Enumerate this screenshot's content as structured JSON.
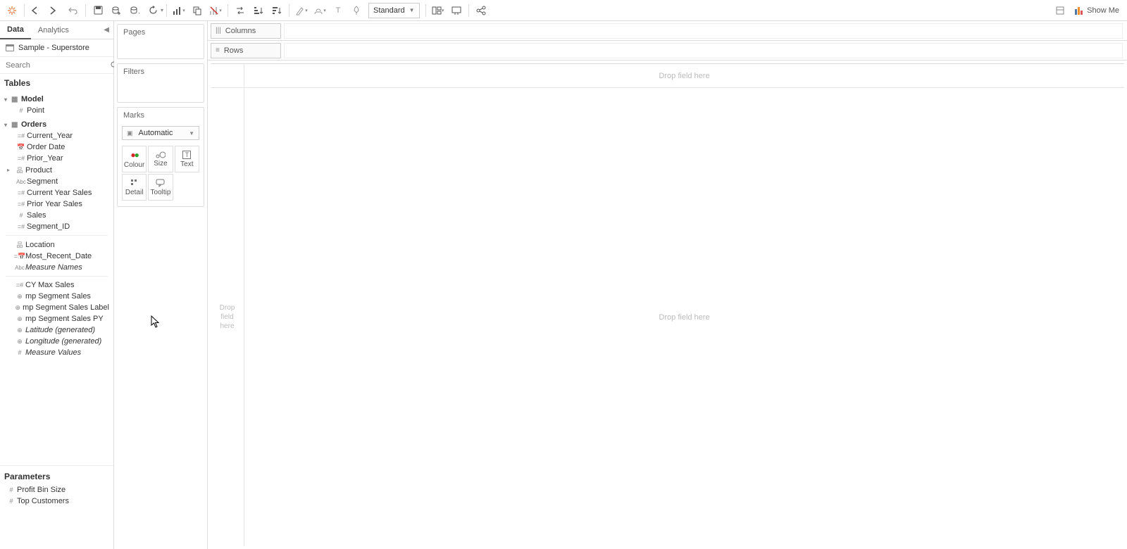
{
  "toolbar": {
    "fit_dropdown": "Standard",
    "showme": "Show Me"
  },
  "side": {
    "tabs": [
      "Data",
      "Analytics"
    ],
    "datasource": "Sample - Superstore",
    "search_placeholder": "Search",
    "tables_hdr": "Tables",
    "groups": [
      {
        "name": "Model",
        "items": [
          {
            "icon": "#",
            "label": "Point"
          }
        ]
      },
      {
        "name": "Orders",
        "items": [
          {
            "icon": "#",
            "label": "Current_Year"
          },
          {
            "icon": "cal",
            "label": "Order Date"
          },
          {
            "icon": "#",
            "label": "Prior_Year"
          },
          {
            "icon": "hier",
            "label": "Product",
            "caret": true
          },
          {
            "icon": "Abc",
            "label": "Segment"
          },
          {
            "icon": "=#",
            "label": "Current Year Sales"
          },
          {
            "icon": "=#",
            "label": "Prior Year Sales"
          },
          {
            "icon": "#",
            "label": "Sales"
          },
          {
            "icon": "=#",
            "label": "Segment_ID"
          }
        ]
      }
    ],
    "extra": [
      {
        "icon": "hier",
        "label": "Location",
        "caret": true
      },
      {
        "icon": "=cal",
        "label": "Most_Recent_Date"
      },
      {
        "icon": "Abc",
        "label": "Measure Names",
        "italic": true
      },
      {
        "icon": "=#",
        "label": "CY Max Sales"
      },
      {
        "icon": "globe",
        "label": "mp Segment Sales"
      },
      {
        "icon": "globe",
        "label": "mp Segment Sales Label"
      },
      {
        "icon": "globe",
        "label": "mp Segment Sales PY"
      },
      {
        "icon": "globe",
        "label": "Latitude (generated)",
        "italic": true
      },
      {
        "icon": "globe",
        "label": "Longitude (generated)",
        "italic": true
      },
      {
        "icon": "#",
        "label": "Measure Values",
        "italic": true
      }
    ],
    "params_hdr": "Parameters",
    "params": [
      {
        "icon": "#",
        "label": "Profit Bin Size"
      },
      {
        "icon": "#",
        "label": "Top Customers"
      }
    ]
  },
  "shelves": {
    "pages": "Pages",
    "filters": "Filters",
    "marks": "Marks",
    "marks_type": "Automatic",
    "mark_btns": [
      "Colour",
      "Size",
      "Text",
      "Detail",
      "Tooltip"
    ]
  },
  "work": {
    "columns": "Columns",
    "rows": "Rows",
    "drop_here": "Drop field here",
    "drop_here_small": "Drop\nfield\nhere"
  }
}
